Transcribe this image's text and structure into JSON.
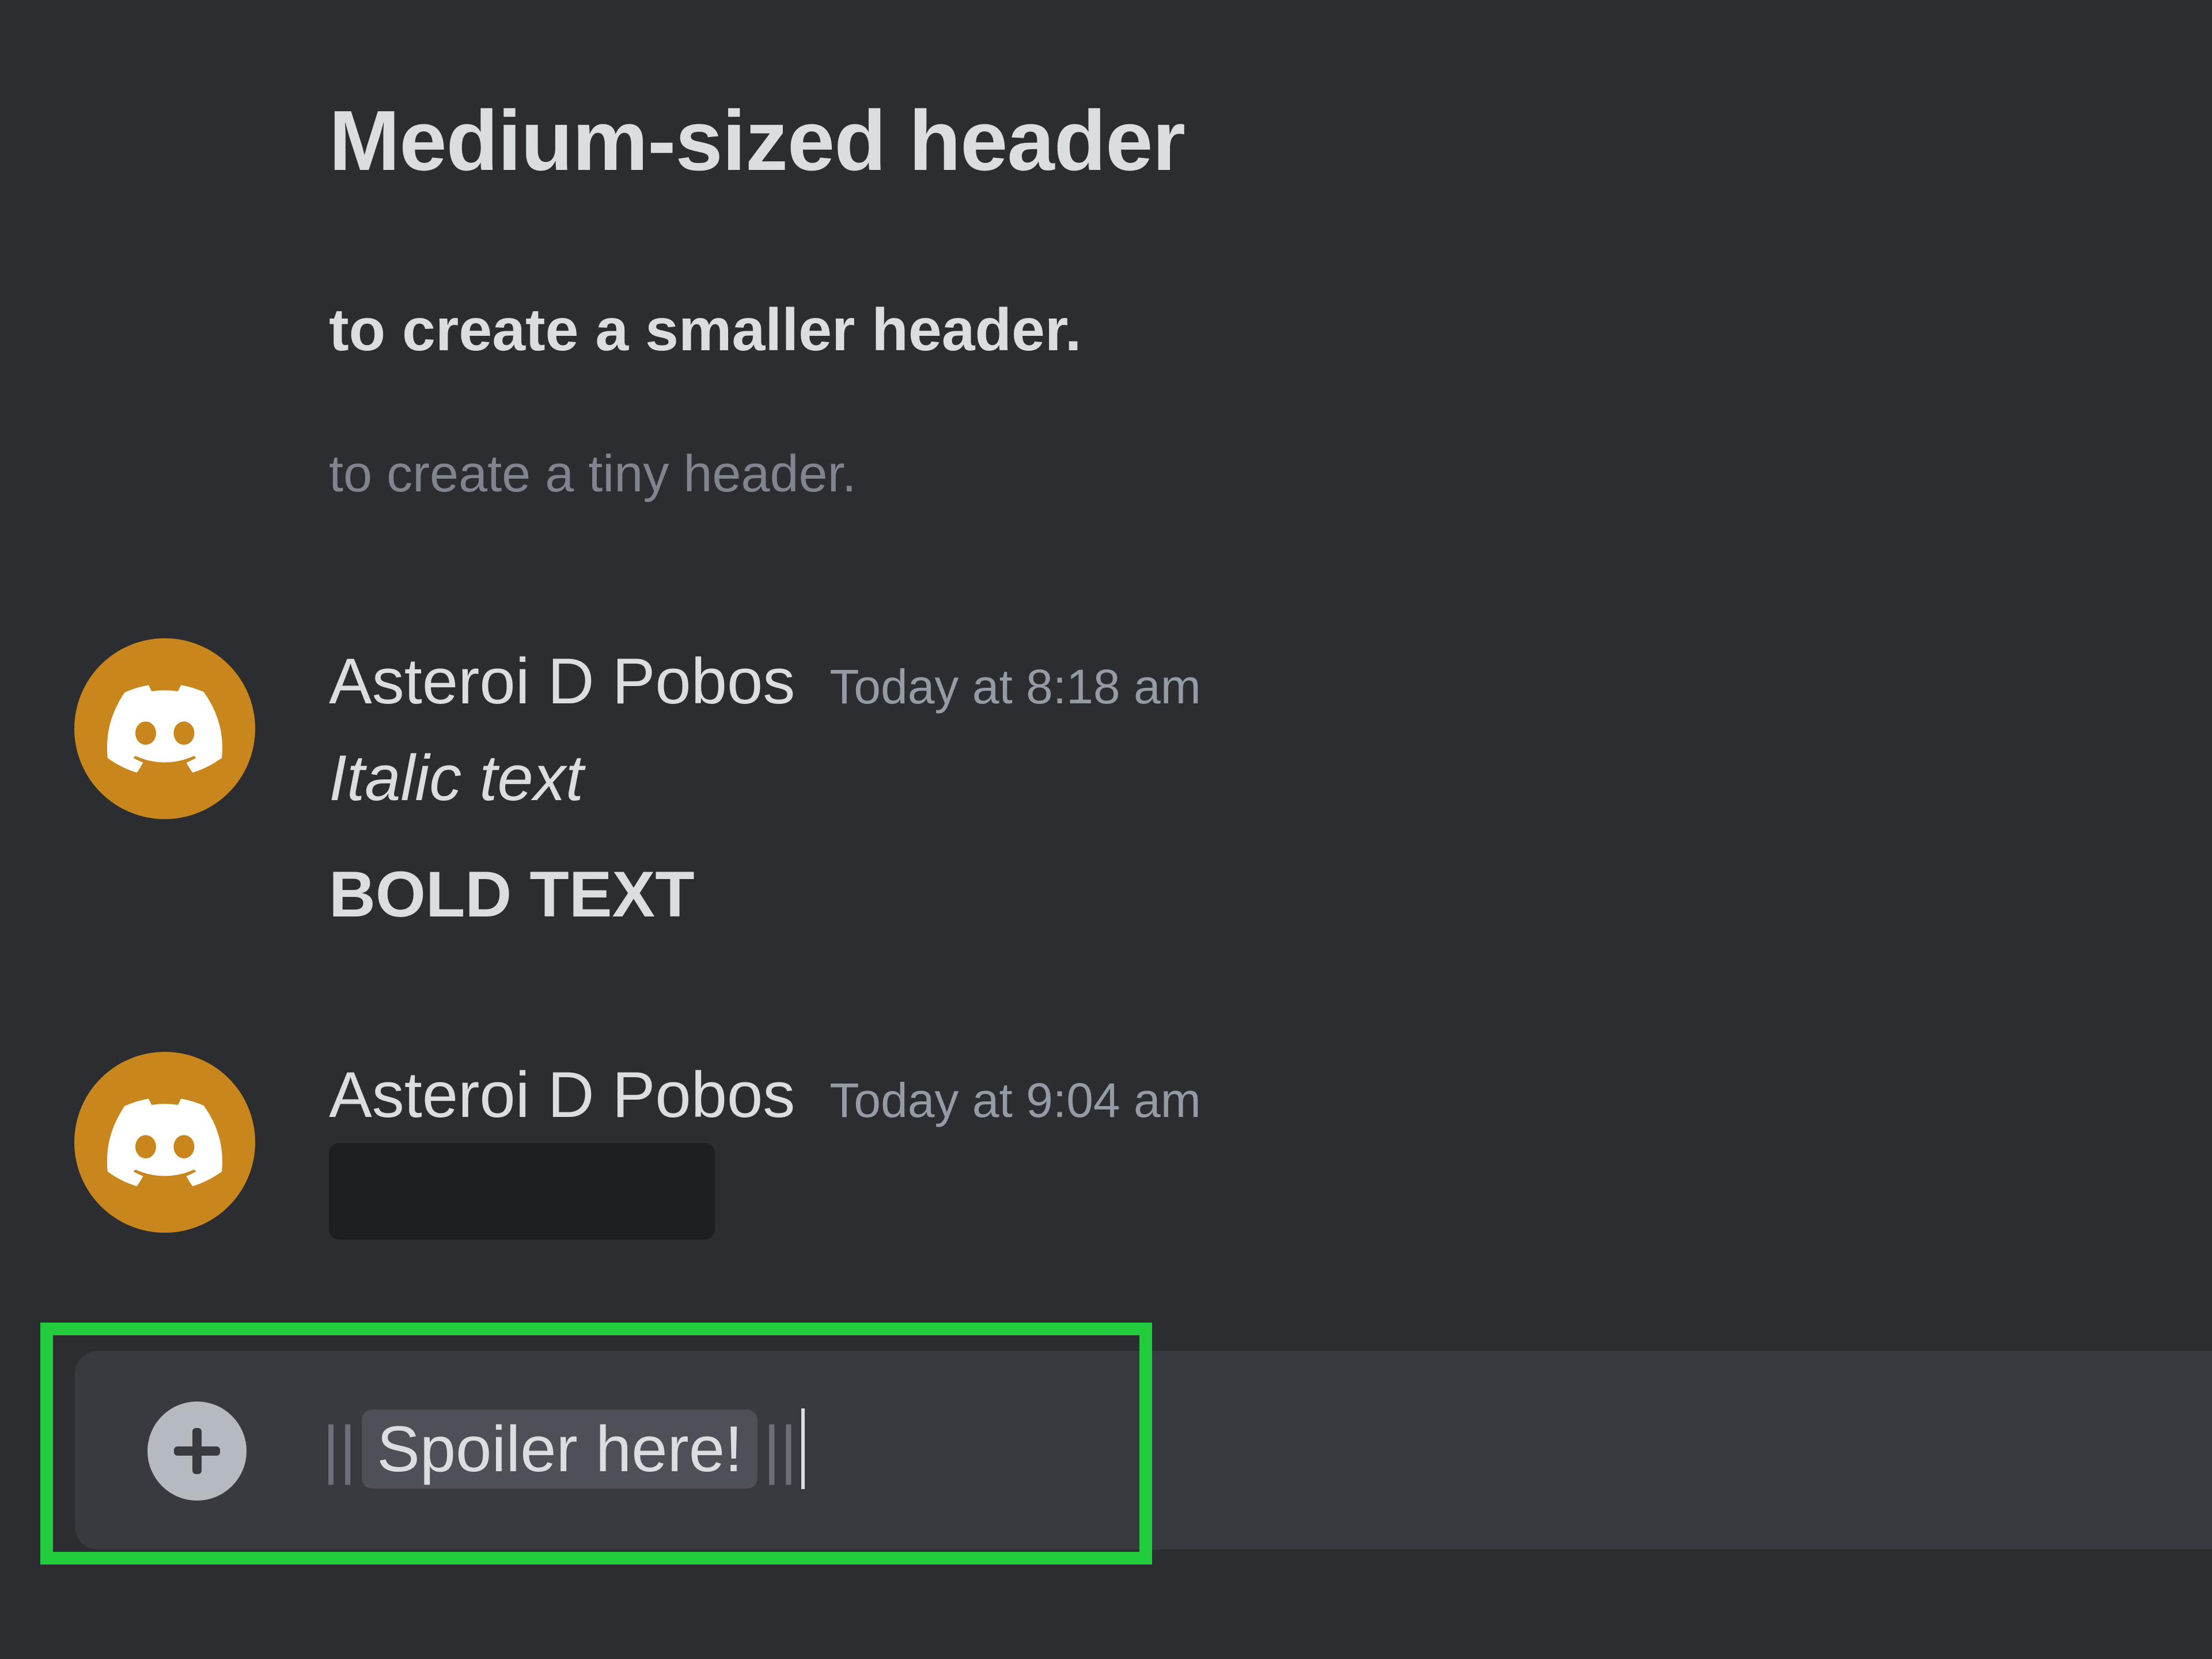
{
  "markdown_preview": {
    "medium_header": "Medium-sized header",
    "smaller_header": "to create a smaller header.",
    "tiny_header": "to create a tiny header."
  },
  "messages": [
    {
      "username": "Asteroi D Pobos",
      "timestamp": "Today at 8:18 am",
      "italic_text": "Italic text",
      "bold_text": "BOLD TEXT",
      "avatar_icon": "discord-logo-icon"
    },
    {
      "username": "Asteroi D Pobos",
      "timestamp": "Today at 9:04 am",
      "content": "spoiler (hidden)",
      "avatar_icon": "discord-logo-icon"
    }
  ],
  "composer": {
    "prefix": "||",
    "spoiler_text": "Spoiler here!",
    "suffix": "||",
    "add_icon": "plus-circle-icon"
  },
  "colors": {
    "background": "#2b2d31",
    "composer": "#383a40",
    "avatar": "#c9861c",
    "highlight": "#22cc3c",
    "spoiler_hidden": "#1e1f22"
  }
}
